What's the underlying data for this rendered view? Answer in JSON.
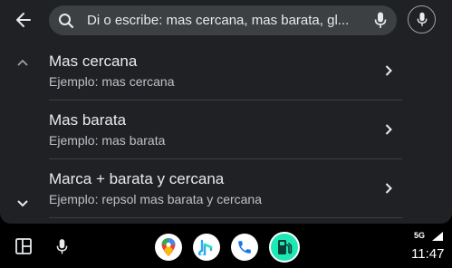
{
  "search": {
    "query": "Di o escribe: mas cercana, mas barata, gl..."
  },
  "suggestions": [
    {
      "title": "Mas cercana",
      "example": "Ejemplo: mas cercana"
    },
    {
      "title": "Mas barata",
      "example": "Ejemplo: mas barata"
    },
    {
      "title": "Marca + barata y cercana",
      "example": "Ejemplo: repsol mas barata y cercana"
    }
  ],
  "status": {
    "network": "5G",
    "time": "11:47"
  },
  "dock": {
    "apps": [
      "google-maps-icon",
      "audio-player-icon",
      "phone-icon",
      "fuel-app-icon"
    ]
  },
  "colors": {
    "background": "#202124",
    "search_bar": "#3c4043",
    "fuel_app_accent": "#1de9b6"
  }
}
